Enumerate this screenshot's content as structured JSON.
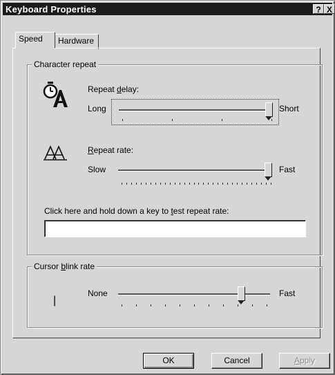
{
  "window": {
    "title": "Keyboard Properties",
    "help_glyph": "?",
    "close_glyph": "X"
  },
  "tabs": [
    {
      "label": "Speed",
      "active": true
    },
    {
      "label": "Hardware",
      "active": false
    }
  ],
  "character_repeat": {
    "legend": "Character repeat",
    "repeat_delay": {
      "label_pre": "Repeat ",
      "label_key": "d",
      "label_post": "elay:",
      "min_label": "Long",
      "max_label": "Short",
      "value_fraction": 1.0,
      "tick_count": 4
    },
    "repeat_rate": {
      "label_pre": "",
      "label_key": "R",
      "label_post": "epeat rate:",
      "min_label": "Slow",
      "max_label": "Fast",
      "value_fraction": 1.0,
      "tick_count": 32
    },
    "test_label_pre": "Click here and hold down a key to ",
    "test_label_key": "t",
    "test_label_post": "est repeat rate:",
    "test_input_value": ""
  },
  "cursor_blink": {
    "legend_pre": "Cursor ",
    "legend_key": "b",
    "legend_post": "link rate",
    "min_label": "None",
    "max_label": "Fast",
    "value_fraction": 0.82,
    "tick_count": 11,
    "cursor_glyph": "|"
  },
  "buttons": {
    "ok": "OK",
    "cancel": "Cancel",
    "apply_pre": "",
    "apply_key": "A",
    "apply_post": "pply"
  },
  "icons": {
    "repeat_delay": "stopwatch-letter-a-icon",
    "repeat_rate": "repeated-letter-a-icon",
    "cursor": "text-cursor-icon"
  }
}
